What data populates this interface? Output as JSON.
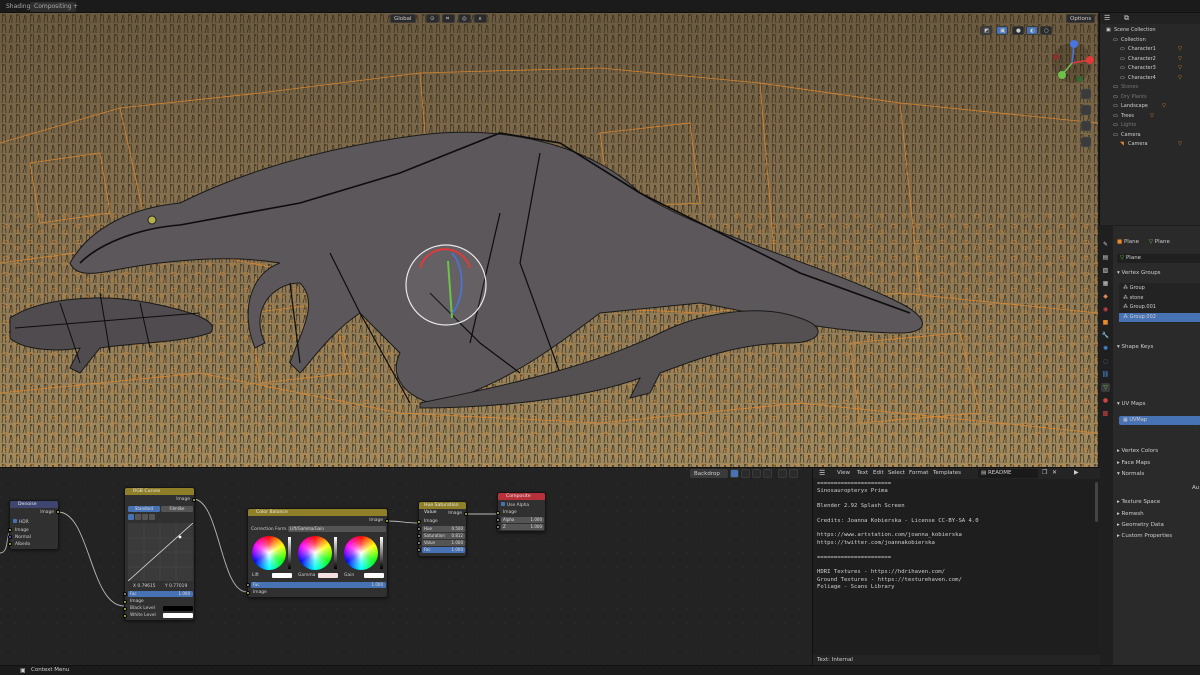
{
  "workspace_tabs": [
    "Shading",
    "Compositing",
    "+"
  ],
  "viewport_header": {
    "transform_orientation": "Global",
    "options_label": "Options"
  },
  "outliner": {
    "items": [
      {
        "label": "Scene Collection",
        "indent": 0,
        "dim": false
      },
      {
        "label": "Collection",
        "indent": 1,
        "dim": false
      },
      {
        "label": "Character1",
        "indent": 2,
        "dim": false
      },
      {
        "label": "Character2",
        "indent": 2,
        "dim": false
      },
      {
        "label": "Character3",
        "indent": 2,
        "dim": false
      },
      {
        "label": "Character4",
        "indent": 2,
        "dim": false
      },
      {
        "label": "Stones",
        "indent": 1,
        "dim": true
      },
      {
        "label": "Dry Plants",
        "indent": 1,
        "dim": true
      },
      {
        "label": "Landscape",
        "indent": 1,
        "dim": false
      },
      {
        "label": "Trees",
        "indent": 1,
        "dim": false
      },
      {
        "label": "Lights",
        "indent": 1,
        "dim": true
      },
      {
        "label": "Camera",
        "indent": 1,
        "dim": false
      },
      {
        "label": "Camera",
        "indent": 2,
        "dim": false
      }
    ]
  },
  "properties": {
    "object_name": "Plane",
    "mesh_name": "Plane",
    "data_name": "Plane",
    "vertex_groups_title": "Vertex Groups",
    "vertex_groups": [
      "Group",
      "stone",
      "Group.001",
      "Group.002"
    ],
    "shape_keys_title": "Shape Keys",
    "uv_maps_title": "UV Maps",
    "uv_maps": [
      "UVMap"
    ],
    "sections": [
      "Vertex Colors",
      "Face Maps",
      "Normals"
    ],
    "auto_label": "Au",
    "sections2": [
      "Texture Space",
      "Remesh",
      "Geometry Data",
      "Custom Properties"
    ]
  },
  "node_editor": {
    "header": {
      "backdrop_label": "Backdrop"
    },
    "denoise": {
      "title": "Denoise",
      "output": "Image",
      "hdr": "HDR",
      "inputs": [
        "Image",
        "Normal",
        "Albedo"
      ]
    },
    "rgb_curves": {
      "title": "RGB Curves",
      "output": "Image",
      "tabs": [
        "Standard",
        "Filmlike"
      ],
      "x_val": "X 0.79615",
      "y_val": "Y 0.77019",
      "fac": "Fac",
      "fac_val": "1.000",
      "inputs": [
        "Image",
        "Black Level",
        "White Level"
      ]
    },
    "color_balance": {
      "title": "Color Balance",
      "output": "Image",
      "method_label": "Correction Form...",
      "method_value": "Lift/Gamma/Gain",
      "wheel_labels": [
        "Lift",
        "Gamma",
        "Gain"
      ],
      "fac": "Fac",
      "fac_val": "1.000",
      "input": "Image"
    },
    "hue_sat": {
      "title": "Hue Saturation Value",
      "output": "Image",
      "rows": [
        {
          "label": "Hue",
          "value": "0.500"
        },
        {
          "label": "Saturation",
          "value": "0.812"
        },
        {
          "label": "Value",
          "value": "1.000"
        },
        {
          "label": "Fac",
          "value": "1.000"
        }
      ],
      "input": "Image"
    },
    "composite": {
      "title": "Composite",
      "use_alpha": "Use Alpha",
      "input": "Image",
      "rows": [
        {
          "label": "Alpha",
          "value": "1.000"
        },
        {
          "label": "Z",
          "value": "1.000"
        }
      ]
    }
  },
  "text_editor": {
    "menu": [
      "View",
      "Text",
      "Edit",
      "Select",
      "Format",
      "Templates"
    ],
    "filename": "README",
    "lines": [
      "======================",
      "Sinosauropteryx Prima",
      "",
      "Blender 2.92 Splash Screen",
      "",
      "Credits: Joanna Kobierska - License CC-BY-SA 4.0",
      "",
      "https://www.artstation.com/joanna_kobierska",
      "https://twitter.com/joannakobierska",
      "",
      "======================",
      "",
      "HDRI Textures - https://hdrihaven.com/",
      "Ground Textures - https://texturehaven.com/",
      "Foliage - Scans Library"
    ],
    "footer": "Text: Internal"
  },
  "statusbar": {
    "context_menu": "Context Menu"
  },
  "colors": {
    "accent": "#4772b3",
    "selection_orange": "#e8892a",
    "node_converter": "#8f7f28",
    "node_output": "#b8303a",
    "node_filter": "#3e4670"
  }
}
